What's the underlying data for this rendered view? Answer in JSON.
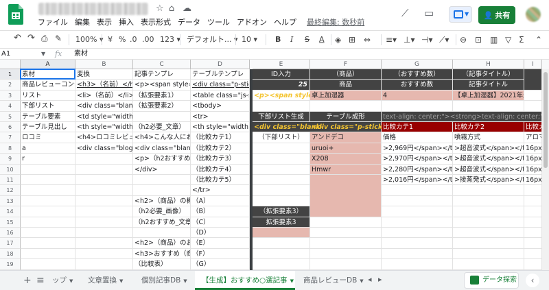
{
  "app": {
    "menu": [
      "ファイル",
      "編集",
      "表示",
      "挿入",
      "表示形式",
      "データ",
      "ツール",
      "アドオン",
      "ヘルプ"
    ],
    "last_edit": "最終編集: 数秒前",
    "share_label": "共有",
    "share_icon": "person-add-icon"
  },
  "toolbar": {
    "zoom": "100%",
    "currency": "¥",
    "percent": "%",
    "dec_less": ".0",
    "dec_more": ".00",
    "more_formats": "123",
    "font": "デフォルト...",
    "font_size": "10",
    "bold": "B",
    "italic": "I",
    "strike": "S",
    "text_color": "A"
  },
  "formula_bar": {
    "name_box": "A1",
    "fx": "fx",
    "value": "素材"
  },
  "columns": [
    "A",
    "B",
    "C",
    "D",
    "E",
    "F",
    "G",
    "H",
    "I",
    "J"
  ],
  "rows": [
    "1",
    "2",
    "3",
    "4",
    "5",
    "6",
    "7",
    "8",
    "9",
    "10",
    "11",
    "12",
    "13",
    "14",
    "15",
    "16",
    "17",
    "18",
    "19"
  ],
  "cells": [
    {
      "col": 0,
      "row": 0,
      "text": "素材",
      "style": "hdr"
    },
    {
      "col": 1,
      "row": 0,
      "text": "変換",
      "style": "hdr"
    },
    {
      "col": 2,
      "row": 0,
      "text": "記事テンプレ",
      "style": "hdr"
    },
    {
      "col": 3,
      "row": 0,
      "text": "テーブルテンプレ",
      "style": "hdr"
    },
    {
      "col": 0,
      "row": 1,
      "text": "商品レビューコンテンツ"
    },
    {
      "col": 0,
      "row": 2,
      "text": "リスト"
    },
    {
      "col": 0,
      "row": 3,
      "text": "下部リスト"
    },
    {
      "col": 0,
      "row": 4,
      "text": "テーブル要素"
    },
    {
      "col": 0,
      "row": 5,
      "text": "テーブル見出し"
    },
    {
      "col": 0,
      "row": 6,
      "text": "ロコミ"
    },
    {
      "col": 0,
      "row": 7,
      "text": "a"
    },
    {
      "col": 0,
      "row": 8,
      "text": "r"
    },
    {
      "col": 1,
      "row": 1,
      "text": "<h3>（名前）</h3>",
      "style": "ul"
    },
    {
      "col": 1,
      "row": 2,
      "text": "<li>（名前）</li> $"
    },
    {
      "col": 1,
      "row": 3,
      "text": "<div class=\"blank-box"
    },
    {
      "col": 1,
      "row": 4,
      "text": "<td style=\"width: 14"
    },
    {
      "col": 1,
      "row": 5,
      "text": "<th style=\"width: 14"
    },
    {
      "col": 1,
      "row": 6,
      "text": "<h4>ロコミレビュー"
    },
    {
      "col": 1,
      "row": 7,
      "text": "<div class=\"blogcard"
    },
    {
      "col": 2,
      "row": 1,
      "text": "<p><span style=\"font"
    },
    {
      "col": 2,
      "row": 2,
      "text": "（拡張要素1）"
    },
    {
      "col": 2,
      "row": 3,
      "text": "（拡張要素2）"
    },
    {
      "col": 2,
      "row": 5,
      "text": "（h2必要_文章）"
    },
    {
      "col": 2,
      "row": 6,
      "text": "<h4>こんな人におすすめ"
    },
    {
      "col": 2,
      "row": 7,
      "text": "<div class=\"blank-box"
    },
    {
      "col": 2,
      "row": 8,
      "text": "<p>（h2おすすめポイント"
    },
    {
      "col": 2,
      "row": 9,
      "text": "</div>"
    },
    {
      "col": 2,
      "row": 12,
      "text": "<h2>（商品）の概要"
    },
    {
      "col": 2,
      "row": 13,
      "text": "（h2必要_画像）"
    },
    {
      "col": 2,
      "row": 14,
      "text": "（h2おすすめ_文章）"
    },
    {
      "col": 2,
      "row": 16,
      "text": "<h2>（商品）のおすすめ"
    },
    {
      "col": 2,
      "row": 17,
      "text": "<h3>おすすめ（商品）"
    },
    {
      "col": 2,
      "row": 18,
      "text": "（比較表）"
    },
    {
      "col": 3,
      "row": 1,
      "text": "<div class=\"p-sticky",
      "style": "ul"
    },
    {
      "col": 3,
      "row": 2,
      "text": "<table class=\"js-scroll"
    },
    {
      "col": 3,
      "row": 3,
      "text": "<tbody>"
    },
    {
      "col": 3,
      "row": 4,
      "text": "<tr>"
    },
    {
      "col": 3,
      "row": 5,
      "text": "<th style=\"width: 40"
    },
    {
      "col": 3,
      "row": 6,
      "text": "（比較カテ1）"
    },
    {
      "col": 3,
      "row": 7,
      "text": "（比較カテ2）"
    },
    {
      "col": 3,
      "row": 8,
      "text": "（比較カテ3）"
    },
    {
      "col": 3,
      "row": 9,
      "text": "（比較カテ4）"
    },
    {
      "col": 3,
      "row": 10,
      "text": "（比較カテ5）"
    },
    {
      "col": 3,
      "row": 11,
      "text": "</tr>"
    },
    {
      "col": 3,
      "row": 12,
      "text": "（A）"
    },
    {
      "col": 3,
      "row": 13,
      "text": "（B）"
    },
    {
      "col": 3,
      "row": 14,
      "text": "（C）"
    },
    {
      "col": 3,
      "row": 15,
      "text": "（D）"
    },
    {
      "col": 3,
      "row": 16,
      "text": "（E）"
    },
    {
      "col": 3,
      "row": 17,
      "text": "（F）"
    },
    {
      "col": 3,
      "row": 18,
      "text": "（G）"
    },
    {
      "col": 4,
      "row": 0,
      "text": "ID入力",
      "style": "center"
    },
    {
      "col": 4,
      "row": 1,
      "text": "25",
      "style": "yellow-right"
    },
    {
      "col": 4,
      "row": 2,
      "text": "<p><span style=\"font",
      "style": "yellow"
    },
    {
      "col": 4,
      "row": 4,
      "text": "下部リスト生成",
      "style": "dark-center"
    },
    {
      "col": 4,
      "row": 5,
      "text": "<div class=\"blank-",
      "style": "yellow"
    },
    {
      "col": 4,
      "row": 6,
      "text": "（下部リスト）",
      "style": "center"
    },
    {
      "col": 4,
      "row": 13,
      "text": "（拡張要素3）",
      "style": "dark-center"
    },
    {
      "col": 4,
      "row": 14,
      "text": "拡張要素3",
      "style": "dark-center"
    },
    {
      "col": 5,
      "row": 0,
      "text": "（商品）",
      "style": "center"
    },
    {
      "col": 5,
      "row": 1,
      "text": "商品",
      "style": "center"
    },
    {
      "col": 5,
      "row": 2,
      "text": "卓上加湿器",
      "style": "pink"
    },
    {
      "col": 5,
      "row": 4,
      "text": "テーブル成形",
      "style": "dark-center"
    },
    {
      "col": 5,
      "row": 5,
      "text": "<div class=\"p-sticky-table",
      "style": "yellow"
    },
    {
      "col": 5,
      "row": 6,
      "text": "アンドデコ",
      "style": "pink"
    },
    {
      "col": 5,
      "row": 7,
      "text": "uruoi+",
      "style": "pink"
    },
    {
      "col": 5,
      "row": 8,
      "text": "X208",
      "style": "pink"
    },
    {
      "col": 5,
      "row": 9,
      "text": "Hmwr",
      "style": "pink"
    },
    {
      "col": 6,
      "row": 0,
      "text": "（おすすめ数）",
      "style": "center"
    },
    {
      "col": 6,
      "row": 1,
      "text": "おすすめ数",
      "style": "center"
    },
    {
      "col": 6,
      "row": 2,
      "text": "4",
      "style": "pink"
    },
    {
      "col": 6,
      "row": 4,
      "text": "text-align: center;\"><strong>text-align: center;\"><strong>",
      "style": "grey"
    },
    {
      "col": 6,
      "row": 5,
      "text": "比較カテ1",
      "style": "red"
    },
    {
      "col": 6,
      "row": 6,
      "text": "価格"
    },
    {
      "col": 6,
      "row": 7,
      "text": ">2,969円</span></td> $"
    },
    {
      "col": 6,
      "row": 8,
      "text": ">2,970円</span></td> $"
    },
    {
      "col": 6,
      "row": 9,
      "text": ">2,280円</span></td> $"
    },
    {
      "col": 6,
      "row": 10,
      "text": ">2,016円</span></td> $"
    },
    {
      "col": 7,
      "row": 0,
      "text": "（記事タイトル）",
      "style": "center"
    },
    {
      "col": 7,
      "row": 1,
      "text": "記事タイトル",
      "style": "center"
    },
    {
      "col": 7,
      "row": 2,
      "text": "【卓上加湿器】2021年最",
      "style": "pink"
    },
    {
      "col": 7,
      "row": 5,
      "text": "比較カテ2",
      "style": "red"
    },
    {
      "col": 7,
      "row": 6,
      "text": "噴霧方式"
    },
    {
      "col": 7,
      "row": 7,
      "text": ">超音波式</span></td> $"
    },
    {
      "col": 7,
      "row": 8,
      "text": ">超音波式</span></td> $"
    },
    {
      "col": 7,
      "row": 9,
      "text": ">超音波式</span></td> $"
    },
    {
      "col": 7,
      "row": 10,
      "text": ">接蒸発式</span></td> $"
    },
    {
      "col": 8,
      "row": 5,
      "text": "比較カ",
      "style": "red"
    },
    {
      "col": 8,
      "row": 6,
      "text": "アロマ"
    },
    {
      "col": 8,
      "row": 7,
      "text": "16px;\"><"
    },
    {
      "col": 8,
      "row": 8,
      "text": "16px;\"><"
    },
    {
      "col": 8,
      "row": 9,
      "text": "16px;\"><"
    },
    {
      "col": 8,
      "row": 10,
      "text": "16px;\"><"
    }
  ],
  "sheet_tabs": [
    {
      "label": "ップ",
      "active": false
    },
    {
      "label": "文章置換",
      "active": false
    },
    {
      "label": "個別記事DB",
      "active": false
    },
    {
      "label": "【生成】おすすめ○選記事",
      "active": true
    },
    {
      "label": "商品レビューDB",
      "active": false
    }
  ],
  "explore_label": "データ探索",
  "colors": {
    "header_green": "#188038",
    "yellow_text": "#f4c430",
    "pink_fill": "#e6b8af",
    "dark_fill": "#434343",
    "red_fill": "#980000"
  }
}
